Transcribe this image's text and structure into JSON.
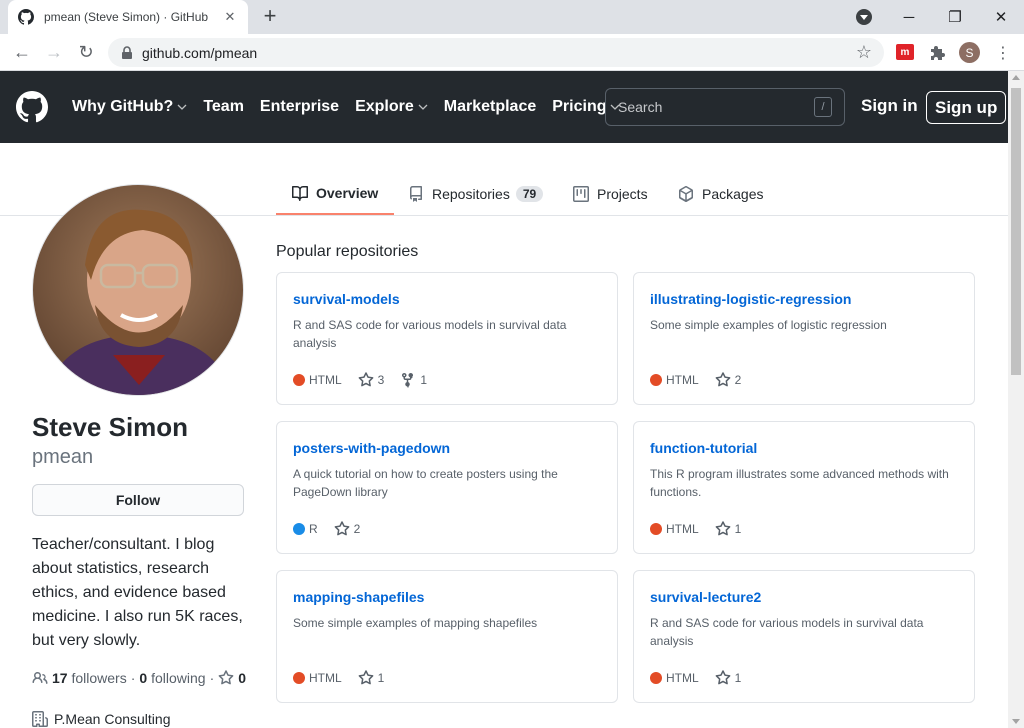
{
  "browser": {
    "tab_title": "pmean (Steve Simon) · GitHub",
    "new_tab": "+",
    "url": "github.com/pmean",
    "profile_initial": "S"
  },
  "header": {
    "nav": [
      "Why GitHub?",
      "Team",
      "Enterprise",
      "Explore",
      "Marketplace",
      "Pricing"
    ],
    "nav_has_caret": [
      true,
      false,
      false,
      true,
      false,
      true
    ],
    "search_placeholder": "Search",
    "search_key": "/",
    "sign_in": "Sign in",
    "sign_up": "Sign up"
  },
  "profile_tabs": {
    "overview": "Overview",
    "repositories": "Repositories",
    "repositories_count": "79",
    "projects": "Projects",
    "packages": "Packages"
  },
  "profile": {
    "name": "Steve Simon",
    "username": "pmean",
    "follow_label": "Follow",
    "bio": "Teacher/consultant. I blog about statistics, research ethics, and evidence based medicine. I also run 5K races, but very slowly.",
    "followers_count": "17",
    "followers_label": "followers",
    "following_count": "0",
    "following_label": "following",
    "stars_count": "0",
    "company": "P.Mean Consulting"
  },
  "popular": {
    "title": "Popular repositories",
    "repos": [
      {
        "name": "survival-models",
        "desc": "R and SAS code for various models in survival data analysis",
        "lang": "HTML",
        "lang_color": "#e34c26",
        "stars": "3",
        "forks": "1"
      },
      {
        "name": "illustrating-logistic-regression",
        "desc": "Some simple examples of logistic regression",
        "lang": "HTML",
        "lang_color": "#e34c26",
        "stars": "2",
        "forks": ""
      },
      {
        "name": "posters-with-pagedown",
        "desc": "A quick tutorial on how to create posters using the PageDown library",
        "lang": "R",
        "lang_color": "#198ce7",
        "stars": "2",
        "forks": ""
      },
      {
        "name": "function-tutorial",
        "desc": "This R program illustrates some advanced methods with functions.",
        "lang": "HTML",
        "lang_color": "#e34c26",
        "stars": "1",
        "forks": ""
      },
      {
        "name": "mapping-shapefiles",
        "desc": "Some simple examples of mapping shapefiles",
        "lang": "HTML",
        "lang_color": "#e34c26",
        "stars": "1",
        "forks": ""
      },
      {
        "name": "survival-lecture2",
        "desc": "R and SAS code for various models in survival data analysis",
        "lang": "HTML",
        "lang_color": "#e34c26",
        "stars": "1",
        "forks": ""
      }
    ]
  }
}
